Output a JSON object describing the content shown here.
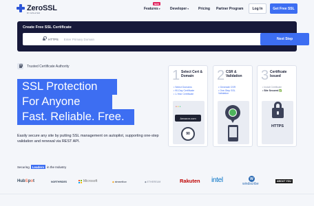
{
  "brand": {
    "name": "ZeroSSL",
    "sub": "BY APILAYER"
  },
  "nav": {
    "items": [
      {
        "label": "Features",
        "caret": "▾"
      },
      {
        "label": "Developer",
        "caret": "▾"
      },
      {
        "label": "Pricing"
      },
      {
        "label": "Partner Program"
      }
    ],
    "new_badge": "NEW",
    "login": "Log In",
    "get_free": "Get Free SSL"
  },
  "create": {
    "label": "Create Free SSL Certificate",
    "protocol": "HTTPS",
    "placeholder": "Enter Primary Domain",
    "next": "Next Step"
  },
  "hero": {
    "trusted": "Trusted Certificate Authority",
    "line1": "SSL Protection",
    "line2": "For Anyone",
    "line3": "Fast. Reliable. Free.",
    "description": "Easily secure any site by putting SSL management on autopilot, supporting one-step validation and renewal via REST API."
  },
  "cards": [
    {
      "num": "1",
      "title": "Select Cert & Domain",
      "bullets": [
        "Select Domains",
        "90-Day Certificate",
        "1-Year Certificate"
      ],
      "ill_label": "Amazon.com",
      "ill_value": "90"
    },
    {
      "num": "2",
      "title": "CSR & Validation",
      "bullets": [
        "Generate CSR",
        "One-Step SSL Validation"
      ]
    },
    {
      "num": "3",
      "title": "Certificate Issued",
      "bullets": [
        "Install Certificate",
        "Site Secured ✅"
      ],
      "ill_label": "HTTPS"
    }
  ],
  "leaders": {
    "prefix": "Securing",
    "highlight": "Leaders",
    "suffix": "in the Industry",
    "logos": [
      "HubSpot",
      "NORTHRIDES",
      "Microsoft",
      "streamflow",
      "ETHEREUM",
      "Rakuten",
      "intel",
      "windscribe",
      "ABOUT YOU"
    ]
  },
  "colors": {
    "accent": "#3d6ef2",
    "dark": "#17193a",
    "text": "#1a1f36"
  }
}
